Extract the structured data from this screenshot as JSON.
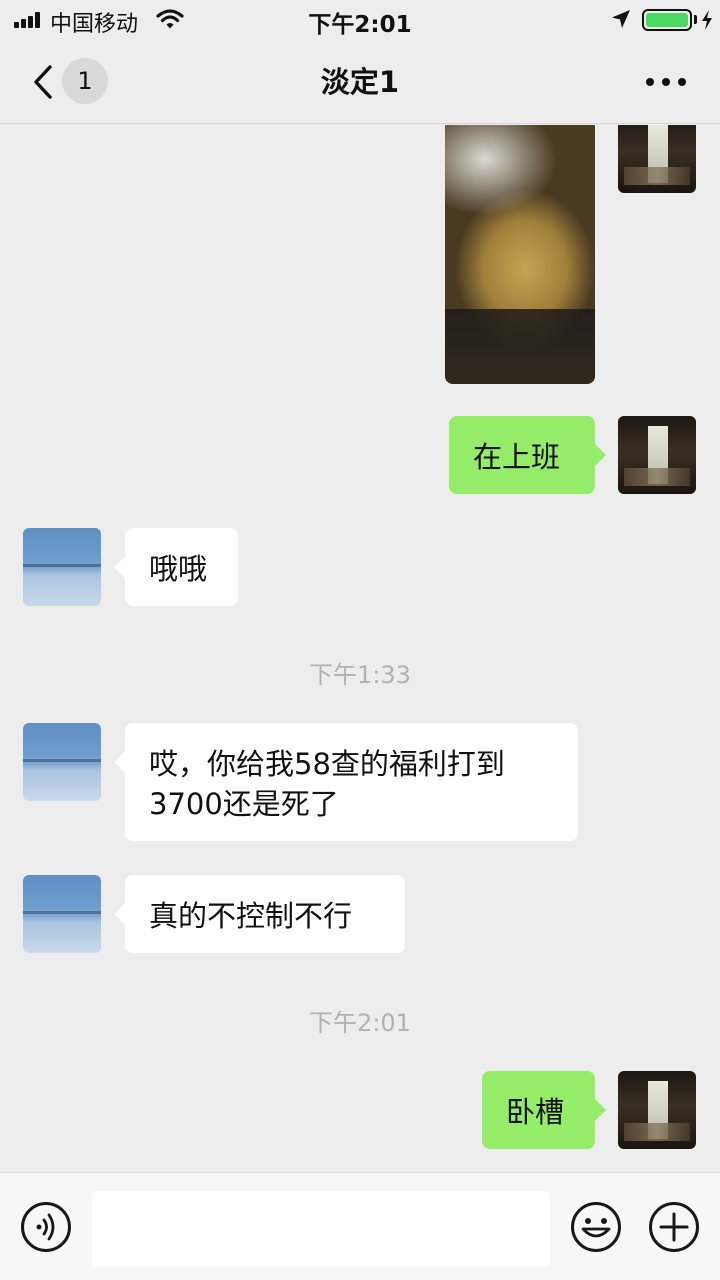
{
  "status_bar": {
    "carrier": "中国移动",
    "time": "下午2:01",
    "battery_color": "#4cd964"
  },
  "nav": {
    "back_badge": "1",
    "title": "淡定1",
    "more_icon": "more-dots-icon"
  },
  "messages": [
    {
      "type": "image",
      "from": "me",
      "description_icon": "food-photo"
    },
    {
      "type": "text",
      "from": "me",
      "text": "在上班"
    },
    {
      "type": "text",
      "from": "other",
      "text": "哦哦"
    },
    {
      "type": "time",
      "text": "下午1:33"
    },
    {
      "type": "text",
      "from": "other",
      "lines": [
        "哎，你给我58查的福利打到",
        "3700还是死了"
      ]
    },
    {
      "type": "text",
      "from": "other",
      "text": "真的不控制不行"
    },
    {
      "type": "time",
      "text": "下午2:01"
    },
    {
      "type": "text",
      "from": "me",
      "text": "卧槽"
    }
  ],
  "input_bar": {
    "voice_icon": "voice-icon",
    "emoji_icon": "emoji-icon",
    "plus_icon": "plus-icon",
    "value": ""
  },
  "colors": {
    "background": "#ededed",
    "my_bubble": "#95ec69",
    "their_bubble": "#ffffff",
    "timestamp": "#b2b2b2"
  }
}
